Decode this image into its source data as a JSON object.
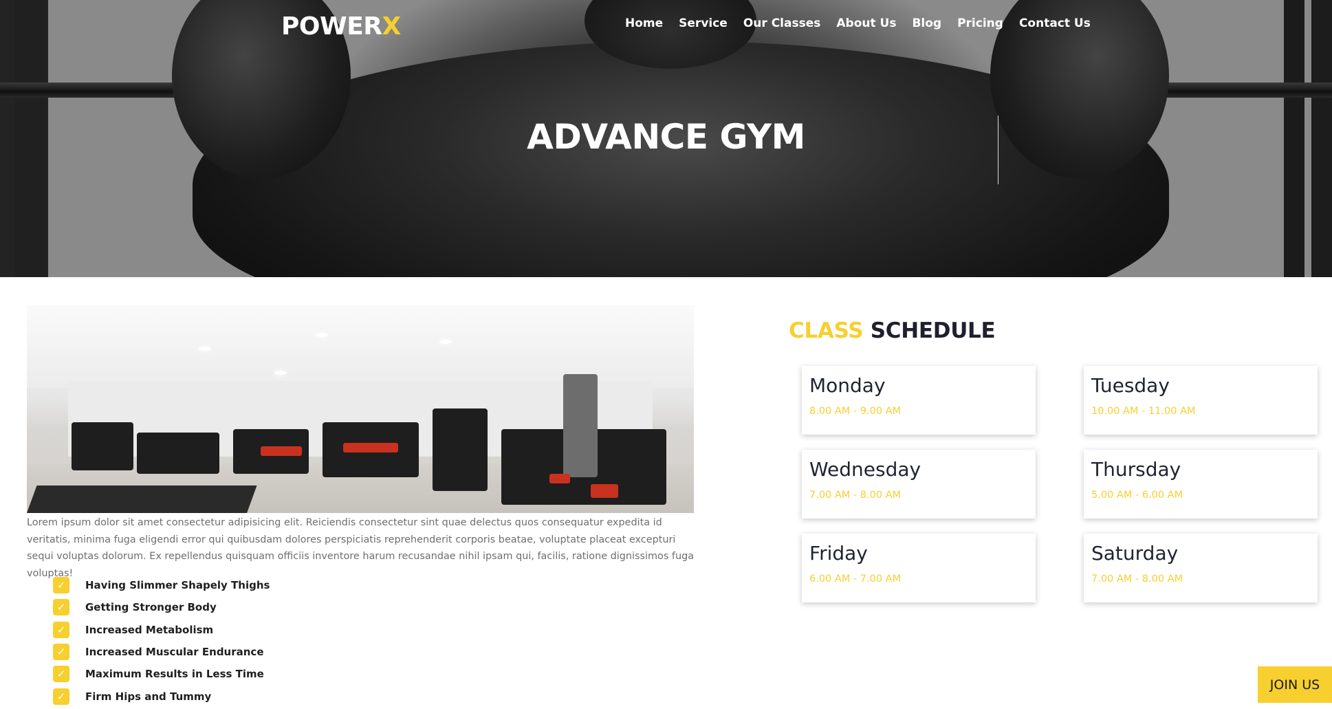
{
  "brand": {
    "name_main": "POWER",
    "name_accent": "X",
    "accent_color": "#f7cf2f"
  },
  "nav": {
    "items": [
      {
        "label": "Home"
      },
      {
        "label": "Service"
      },
      {
        "label": "Our Classes"
      },
      {
        "label": "About Us"
      },
      {
        "label": "Blog"
      },
      {
        "label": "Pricing"
      },
      {
        "label": "Contact Us"
      }
    ]
  },
  "hero": {
    "title": "ADVANCE GYM"
  },
  "about": {
    "text": "Lorem ipsum dolor sit amet consectetur adipisicing elit. Reiciendis consectetur sint quae delectus quos consequatur expedita id veritatis, minima fuga eligendi error qui quibusdam dolores perspiciatis reprehenderit corporis beatae, voluptate placeat excepturi sequi voluptas dolorum. Ex repellendus quisquam officiis inventore harum recusandae nihil ipsam qui, facilis, ratione dignissimos fuga voluptas!",
    "benefits": [
      "Having Slimmer Shapely Thighs",
      "Getting Stronger Body",
      "Increased Metabolism",
      "Increased Muscular Endurance",
      "Maximum Results in Less Time",
      "Firm Hips and Tummy"
    ],
    "check_icon": "check-icon"
  },
  "schedule": {
    "title_accent": "CLASS",
    "title_rest": " SCHEDULE",
    "days": [
      {
        "day": "Monday",
        "time": "8.00 AM - 9.00 AM"
      },
      {
        "day": "Tuesday",
        "time": "10.00 AM - 11.00 AM"
      },
      {
        "day": "Wednesday",
        "time": "7.00 AM - 8.00 AM"
      },
      {
        "day": "Thursday",
        "time": "5.00 AM - 6.00 AM"
      },
      {
        "day": "Friday",
        "time": "6.00 AM - 7.00 AM"
      },
      {
        "day": "Saturday",
        "time": "7.00 AM - 8.00 AM"
      }
    ]
  },
  "cta": {
    "join_label": "JOIN US"
  }
}
